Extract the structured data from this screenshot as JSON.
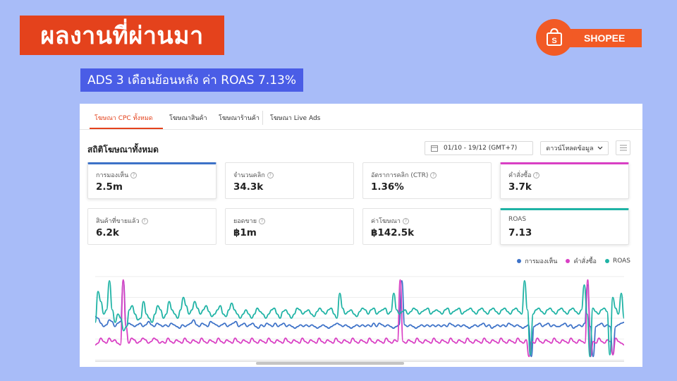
{
  "slide": {
    "title": "ผลงานที่ผ่านมา",
    "subtitle": "ADS 3 เดือนย้อนหลัง ค่า ROAS 7.13%",
    "brand": {
      "name": "SHOPEE",
      "logo_letter": "S",
      "color": "#f25a25"
    }
  },
  "tabs": [
    {
      "label": "โฆษณา CPC ทั้งหมด",
      "active": true
    },
    {
      "label": "โฆษณาสินค้า",
      "active": false
    },
    {
      "label": "โฆษณาร้านค้า",
      "active": false
    },
    {
      "label": "โฆษณา Live Ads",
      "active": false
    }
  ],
  "panel": {
    "title": "สถิติโฆษณาทั้งหมด",
    "date_range": "01/10 - 19/12 (GMT+7)",
    "download_label": "ดาวน์โหลดข้อมูล",
    "icons": {
      "date": "calendar-icon",
      "download": "chevron-down-icon",
      "menu": "list-icon",
      "help": "question-circle-icon"
    }
  },
  "metrics": [
    {
      "label": "การมองเห็น",
      "value": "2.5m",
      "selected": true,
      "color": "#3d72c8"
    },
    {
      "label": "จำนวนคลิก",
      "value": "34.3k",
      "selected": false
    },
    {
      "label": "อัตราการคลิก (CTR)",
      "value": "1.36%",
      "selected": false
    },
    {
      "label": "คำสั่งซื้อ",
      "value": "3.7k",
      "selected": true,
      "color": "#d93fc4"
    },
    {
      "label": "สินค้าที่ขายแล้ว",
      "value": "6.2k",
      "selected": false
    },
    {
      "label": "ยอดขาย",
      "value": "฿1m",
      "selected": false
    },
    {
      "label": "ค่าโฆษณา",
      "value": "฿142.5k",
      "selected": false
    },
    {
      "label": "ROAS",
      "value": "7.13",
      "selected": true,
      "color": "#1fb3a5"
    }
  ],
  "legend": [
    {
      "label": "การมองเห็น",
      "color": "#3d72c8"
    },
    {
      "label": "คำสั่งซื้อ",
      "color": "#d93fc4"
    },
    {
      "label": "ROAS",
      "color": "#1fb3a5"
    }
  ],
  "chart_data": {
    "type": "line",
    "x_label": "",
    "y_label": "",
    "grid": true,
    "legend_position": "top-right",
    "y_range": [
      0,
      1
    ],
    "series": [
      {
        "name": "การมองเห็น",
        "color": "#3d72c8",
        "values": [
          0.52,
          0.5,
          0.44,
          0.4,
          0.42,
          0.48,
          0.46,
          0.4,
          0.44,
          0.46,
          0.95,
          0.4,
          0.44,
          0.42,
          0.4,
          0.42,
          0.44,
          0.4,
          0.42,
          0.46,
          0.42,
          0.4,
          0.44,
          0.42,
          0.4,
          0.42,
          0.4,
          0.44,
          0.42,
          0.4,
          0.38,
          0.42,
          0.4,
          0.42,
          0.44,
          0.48,
          0.42,
          0.4,
          0.44,
          0.42,
          0.4,
          0.46,
          0.44,
          0.42,
          0.4,
          0.42,
          0.44,
          0.4,
          0.42,
          0.44,
          0.46,
          0.4,
          0.42,
          0.44,
          0.4,
          0.42,
          0.44,
          0.4,
          0.38,
          0.42,
          0.4,
          0.44,
          0.42,
          0.4,
          0.44,
          0.4,
          0.42,
          0.44,
          0.4,
          0.42,
          0.4,
          0.38,
          0.4,
          0.42,
          0.4,
          0.42,
          0.4,
          0.42,
          0.4,
          0.38,
          0.4,
          0.42,
          0.4,
          0.38,
          0.4,
          0.42,
          0.44,
          0.42,
          0.4,
          0.42,
          0.4,
          0.38,
          0.4,
          0.42,
          0.4,
          0.42,
          0.4,
          0.42,
          0.4,
          0.44,
          0.4,
          0.44,
          0.42,
          0.4,
          0.42,
          0.4,
          0.38,
          0.4,
          0.42,
          0.95,
          0.42,
          0.4,
          0.42,
          0.4,
          0.38,
          0.4,
          0.42,
          0.4,
          0.42,
          0.4,
          0.42,
          0.4,
          0.42,
          0.4,
          0.42,
          0.4,
          0.44,
          0.42,
          0.4,
          0.42,
          0.4,
          0.42,
          0.4,
          0.38,
          0.4,
          0.42,
          0.4,
          0.42,
          0.44,
          0.4,
          0.42,
          0.38,
          0.4,
          0.42,
          0.4,
          0.42,
          0.4,
          0.44,
          0.42,
          0.4,
          0.42,
          0.4,
          0.38,
          0.4,
          0.42,
          0.04,
          0.4,
          0.42,
          0.44,
          0.4,
          0.42,
          0.44,
          0.4,
          0.42,
          0.4,
          0.4,
          0.42,
          0.44,
          0.4,
          0.42,
          0.38,
          0.4,
          0.42,
          0.4,
          0.44,
          0.9,
          0.4,
          0.04,
          0.4,
          0.42,
          0.44,
          0.4,
          0.42,
          0.4,
          0.06,
          0.4,
          0.42,
          0.44,
          0.45
        ]
      },
      {
        "name": "คำสั่งซื้อ",
        "color": "#d93fc4",
        "values": [
          0.18,
          0.2,
          0.26,
          0.22,
          0.2,
          0.26,
          0.22,
          0.24,
          0.2,
          0.18,
          0.96,
          0.4,
          0.2,
          0.26,
          0.24,
          0.2,
          0.22,
          0.26,
          0.24,
          0.2,
          0.22,
          0.26,
          0.24,
          0.2,
          0.22,
          0.2,
          0.26,
          0.22,
          0.2,
          0.24,
          0.22,
          0.2,
          0.26,
          0.22,
          0.2,
          0.24,
          0.22,
          0.2,
          0.26,
          0.22,
          0.2,
          0.24,
          0.22,
          0.2,
          0.26,
          0.22,
          0.2,
          0.24,
          0.22,
          0.2,
          0.26,
          0.22,
          0.2,
          0.24,
          0.22,
          0.2,
          0.26,
          0.22,
          0.2,
          0.24,
          0.22,
          0.2,
          0.26,
          0.22,
          0.2,
          0.24,
          0.22,
          0.2,
          0.26,
          0.22,
          0.2,
          0.24,
          0.22,
          0.2,
          0.26,
          0.22,
          0.2,
          0.24,
          0.22,
          0.2,
          0.26,
          0.22,
          0.2,
          0.24,
          0.22,
          0.2,
          0.26,
          0.22,
          0.2,
          0.24,
          0.22,
          0.2,
          0.26,
          0.22,
          0.2,
          0.24,
          0.22,
          0.2,
          0.26,
          0.22,
          0.2,
          0.24,
          0.22,
          0.2,
          0.26,
          0.22,
          0.2,
          0.24,
          0.22,
          0.96,
          0.22,
          0.2,
          0.24,
          0.22,
          0.2,
          0.26,
          0.22,
          0.2,
          0.24,
          0.22,
          0.2,
          0.26,
          0.22,
          0.2,
          0.24,
          0.22,
          0.2,
          0.26,
          0.22,
          0.2,
          0.24,
          0.22,
          0.2,
          0.26,
          0.22,
          0.2,
          0.24,
          0.22,
          0.2,
          0.26,
          0.22,
          0.2,
          0.24,
          0.22,
          0.2,
          0.26,
          0.22,
          0.2,
          0.24,
          0.22,
          0.2,
          0.26,
          0.22,
          0.2,
          0.24,
          0.04,
          0.22,
          0.2,
          0.26,
          0.22,
          0.2,
          0.24,
          0.22,
          0.2,
          0.26,
          0.22,
          0.2,
          0.24,
          0.22,
          0.2,
          0.26,
          0.22,
          0.2,
          0.24,
          0.22,
          0.2,
          0.96,
          0.04,
          0.22,
          0.2,
          0.26,
          0.22,
          0.2,
          0.24,
          0.22,
          0.06,
          0.26,
          0.22,
          0.2,
          0.18
        ]
      },
      {
        "name": "ROAS",
        "color": "#1fb3a5",
        "values": [
          0.45,
          0.82,
          0.7,
          0.55,
          0.6,
          0.95,
          0.6,
          0.45,
          0.55,
          0.5,
          0.35,
          0.4,
          0.6,
          0.65,
          0.55,
          0.48,
          0.5,
          0.7,
          0.55,
          0.5,
          0.45,
          0.55,
          0.65,
          0.6,
          0.5,
          0.55,
          0.7,
          0.6,
          0.55,
          0.5,
          0.6,
          0.75,
          0.65,
          0.55,
          0.6,
          0.7,
          0.62,
          0.55,
          0.6,
          0.65,
          0.58,
          0.52,
          0.55,
          0.6,
          0.65,
          0.55,
          0.52,
          0.6,
          0.68,
          0.6,
          0.55,
          0.5,
          0.55,
          0.6,
          0.55,
          0.5,
          0.55,
          0.62,
          0.58,
          0.55,
          0.5,
          0.55,
          0.6,
          0.62,
          0.55,
          0.5,
          0.58,
          0.6,
          0.55,
          0.5,
          0.55,
          0.62,
          0.6,
          0.55,
          0.58,
          0.6,
          0.55,
          0.52,
          0.58,
          0.62,
          0.58,
          0.55,
          0.6,
          0.62,
          0.55,
          0.5,
          0.8,
          0.62,
          0.55,
          0.58,
          0.6,
          0.55,
          0.52,
          0.58,
          0.62,
          0.6,
          0.55,
          0.6,
          0.62,
          0.55,
          0.58,
          0.6,
          0.62,
          0.55,
          0.58,
          0.8,
          0.6,
          0.55,
          0.58,
          0.6,
          0.55,
          0.58,
          0.62,
          0.6,
          0.55,
          0.58,
          0.6,
          0.62,
          0.55,
          0.58,
          0.6,
          0.58,
          0.55,
          0.6,
          0.62,
          0.55,
          0.58,
          0.6,
          0.62,
          0.55,
          0.58,
          0.6,
          0.62,
          0.58,
          0.55,
          0.6,
          0.62,
          0.58,
          0.55,
          0.6,
          0.62,
          0.58,
          0.55,
          0.6,
          0.62,
          0.58,
          0.55,
          0.6,
          0.62,
          0.58,
          0.55,
          0.95,
          0.6,
          0.06,
          0.55,
          0.6,
          0.62,
          0.58,
          0.55,
          0.6,
          0.62,
          0.58,
          0.55,
          0.6,
          0.62,
          0.58,
          0.55,
          0.6,
          0.62,
          0.58,
          0.55,
          0.6,
          0.9,
          0.55,
          0.04,
          0.62,
          0.58,
          0.55,
          0.6,
          0.62,
          0.58,
          0.06,
          0.75,
          0.62,
          0.55,
          0.8,
          0.5
        ]
      }
    ]
  }
}
